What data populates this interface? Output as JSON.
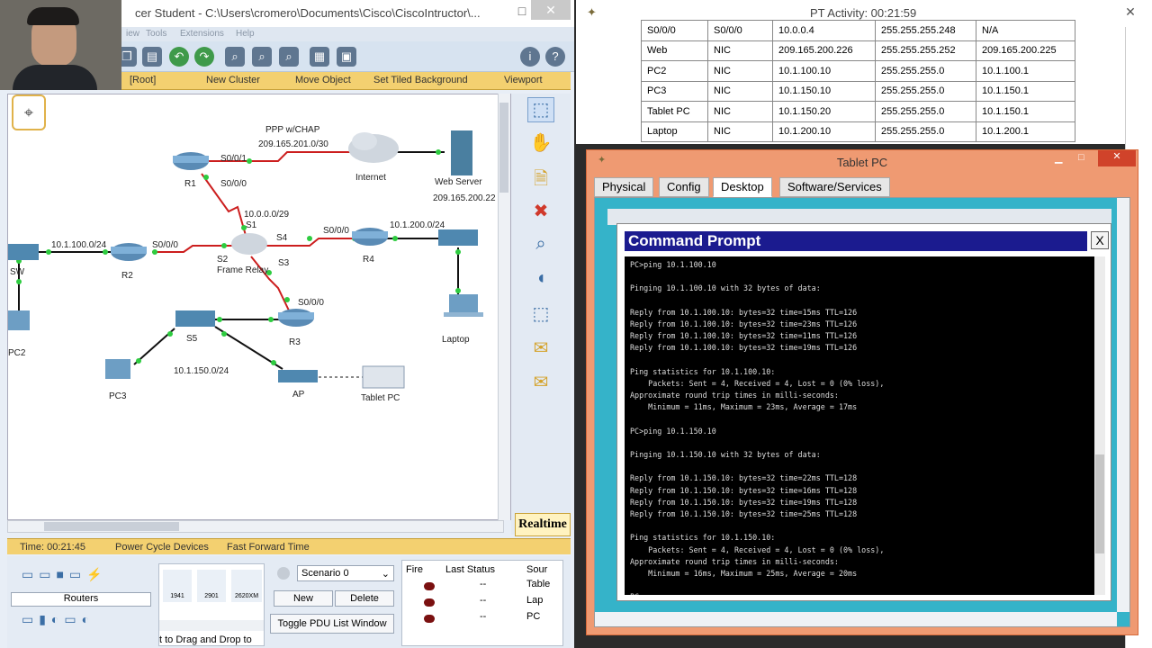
{
  "app": {
    "window_title": "cer Student - C:\\Users\\cromero\\Documents\\Cisco\\CiscoIntructor\\...",
    "menu": [
      "iew",
      "Tools",
      "Extensions",
      "Help"
    ]
  },
  "nav": {
    "root": "[Root]",
    "new_cluster": "New Cluster",
    "move_object": "Move Object",
    "set_bg": "Set Tiled Background",
    "viewport": "Viewport"
  },
  "topology": {
    "ppp_label": "PPP w/CHAP",
    "ppp_net": "209.165.201.0/30",
    "r1": "R1",
    "r1_s001": "S0/0/1",
    "r1_s000": "S0/0/0",
    "internet": "Internet",
    "web_server": "Web Server",
    "web_ip": "209.165.200.22",
    "fr_net": "10.0.0.0/29",
    "s1": "S1",
    "s2": "S2",
    "s3": "S3",
    "s4": "S4",
    "frame_relay": "Frame Relay",
    "r4": "R4",
    "r4_s000": "S0/0/0",
    "r4_net": "10.1.200.0/24",
    "r2": "R2",
    "r2_s000": "S0/0/0",
    "r2_net": "10.1.100.0/24",
    "sw": "SW",
    "pc2": "PC2",
    "r3": "R3",
    "r3_s000": "S0/0/0",
    "s5": "S5",
    "s5_net": "10.1.150.0/24",
    "pc3": "PC3",
    "ap": "AP",
    "tablet": "Tablet PC",
    "laptop": "Laptop"
  },
  "status": {
    "time": "Time: 00:21:45",
    "power_cycle": "Power Cycle Devices",
    "fast_forward": "Fast Forward Time",
    "mode": "Realtime"
  },
  "bottom": {
    "category": "Routers",
    "models": [
      "1941",
      "2901",
      "2620XM"
    ],
    "drag_hint": "t to Drag and Drop to",
    "scenario": "Scenario 0",
    "new_btn": "New",
    "delete_btn": "Delete",
    "toggle_btn": "Toggle PDU List Window",
    "pdu_headers": [
      "Fire",
      "Last Status",
      "Sour"
    ],
    "pdu_rows": [
      {
        "status": "--",
        "source": "Table"
      },
      {
        "status": "--",
        "source": "Lap"
      },
      {
        "status": "--",
        "source": "PC"
      }
    ]
  },
  "activity": {
    "title": "PT Activity: 00:21:59",
    "table": [
      [
        "S0/0/0",
        "S0/0/0",
        "10.0.0.4",
        "255.255.255.248",
        "N/A"
      ],
      [
        "Web",
        "NIC",
        "209.165.200.226",
        "255.255.255.252",
        "209.165.200.225"
      ],
      [
        "PC2",
        "NIC",
        "10.1.100.10",
        "255.255.255.0",
        "10.1.100.1"
      ],
      [
        "PC3",
        "NIC",
        "10.1.150.10",
        "255.255.255.0",
        "10.1.150.1"
      ],
      [
        "Tablet PC",
        "NIC",
        "10.1.150.20",
        "255.255.255.0",
        "10.1.150.1"
      ],
      [
        "Laptop",
        "NIC",
        "10.1.200.10",
        "255.255.255.0",
        "10.1.200.1"
      ]
    ]
  },
  "tablet": {
    "title": "Tablet PC",
    "tabs": [
      "Physical",
      "Config",
      "Desktop",
      "Software/Services"
    ],
    "cmd_title": "Command Prompt",
    "close": "X",
    "lines": [
      "PC>ping 10.1.100.10",
      "",
      "Pinging 10.1.100.10 with 32 bytes of data:",
      "",
      "Reply from 10.1.100.10: bytes=32 time=15ms TTL=126",
      "Reply from 10.1.100.10: bytes=32 time=23ms TTL=126",
      "Reply from 10.1.100.10: bytes=32 time=11ms TTL=126",
      "Reply from 10.1.100.10: bytes=32 time=19ms TTL=126",
      "",
      "Ping statistics for 10.1.100.10:",
      "    Packets: Sent = 4, Received = 4, Lost = 0 (0% loss),",
      "Approximate round trip times in milli-seconds:",
      "    Minimum = 11ms, Maximum = 23ms, Average = 17ms",
      "",
      "PC>ping 10.1.150.10",
      "",
      "Pinging 10.1.150.10 with 32 bytes of data:",
      "",
      "Reply from 10.1.150.10: bytes=32 time=22ms TTL=128",
      "Reply from 10.1.150.10: bytes=32 time=16ms TTL=128",
      "Reply from 10.1.150.10: bytes=32 time=19ms TTL=128",
      "Reply from 10.1.150.10: bytes=32 time=25ms TTL=128",
      "",
      "Ping statistics for 10.1.150.10:",
      "    Packets: Sent = 4, Received = 4, Lost = 0 (0% loss),",
      "Approximate round trip times in milli-seconds:",
      "    Minimum = 16ms, Maximum = 25ms, Average = 20ms",
      "",
      "PC>"
    ]
  }
}
